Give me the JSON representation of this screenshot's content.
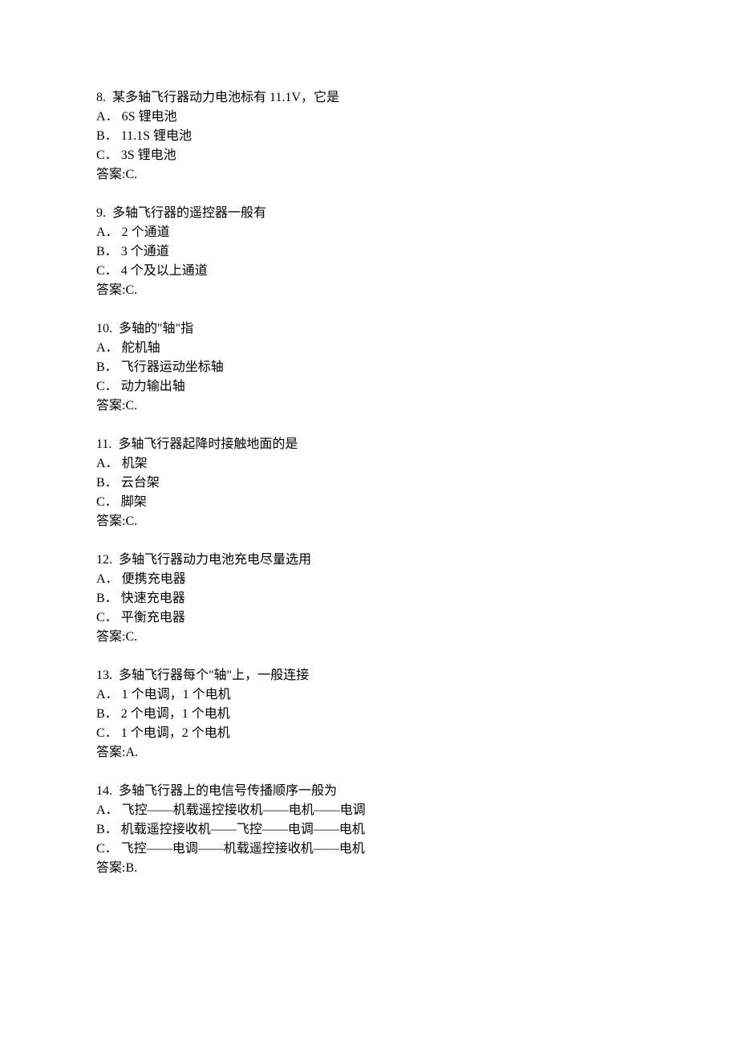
{
  "answer_label_prefix": "答案:",
  "option_labels": [
    "A．",
    "B．",
    "C．"
  ],
  "questions": [
    {
      "num": "8.",
      "text": "某多轴飞行器动力电池标有 11.1V，它是",
      "options": [
        "6S 锂电池",
        "11.1S 锂电池",
        "3S 锂电池"
      ],
      "answer": "C."
    },
    {
      "num": "9.",
      "text": "多轴飞行器的遥控器一般有",
      "options": [
        "2 个通道",
        "3 个通道",
        "4 个及以上通道"
      ],
      "answer": "C."
    },
    {
      "num": "10.",
      "text": "多轴的\"轴\"指",
      "options": [
        "舵机轴",
        "飞行器运动坐标轴",
        "动力输出轴"
      ],
      "answer": "C."
    },
    {
      "num": "11.",
      "text": "多轴飞行器起降时接触地面的是",
      "options": [
        "机架",
        "云台架",
        "脚架"
      ],
      "answer": "C."
    },
    {
      "num": "12.",
      "text": "多轴飞行器动力电池充电尽量选用",
      "options": [
        "便携充电器",
        "快速充电器",
        "平衡充电器"
      ],
      "answer": "C."
    },
    {
      "num": "13.",
      "text": "多轴飞行器每个\"轴\"上，一般连接",
      "options": [
        "1 个电调，1 个电机",
        "2 个电调，1 个电机",
        "1 个电调，2 个电机"
      ],
      "answer": "A."
    },
    {
      "num": "14.",
      "text": "多轴飞行器上的电信号传播顺序一般为",
      "options": [
        "飞控——机载遥控接收机——电机——电调",
        "机载遥控接收机——飞控——电调——电机",
        "飞控——电调——机载遥控接收机——电机"
      ],
      "answer": "B."
    }
  ]
}
